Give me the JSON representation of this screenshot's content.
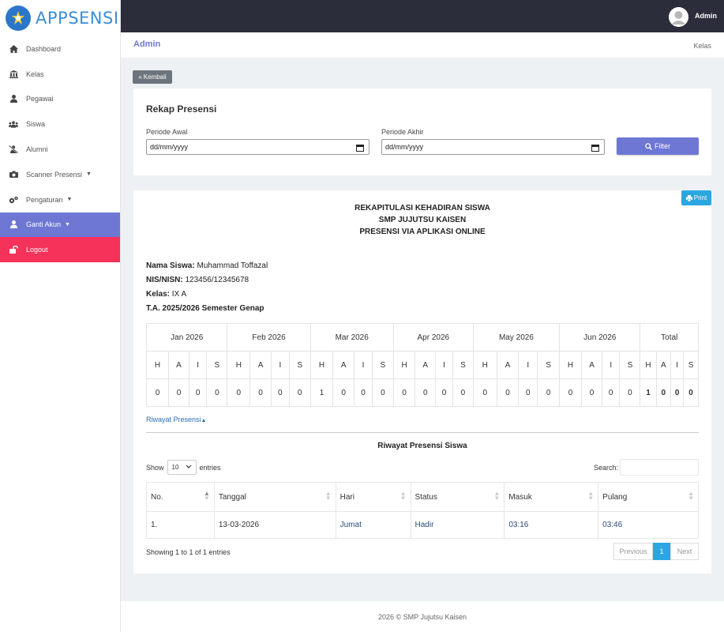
{
  "brand": {
    "name": "APPSENSI"
  },
  "sidebar": {
    "items": [
      {
        "label": "Dashboard",
        "icon": "home-icon"
      },
      {
        "label": "Kelas",
        "icon": "institution-icon"
      },
      {
        "label": "Pegawai",
        "icon": "user-tie-icon"
      },
      {
        "label": "Siswa",
        "icon": "users-icon"
      },
      {
        "label": "Alumni",
        "icon": "user-slash-icon"
      },
      {
        "label": "Scanner Presensi",
        "icon": "camera-icon"
      },
      {
        "label": "Pengaturan",
        "icon": "cogs-icon"
      },
      {
        "label": "Ganti Akun",
        "icon": "user-icon"
      },
      {
        "label": "Logout",
        "icon": "unlock-icon"
      }
    ]
  },
  "topbar": {
    "user": "Admin"
  },
  "breadcrumb": {
    "title": "Admin",
    "right": "Kelas"
  },
  "back_button": {
    "label": "Kembali"
  },
  "filter_card": {
    "title": "Rekap Presensi",
    "start_label": "Periode Awal",
    "start_value": "dd/mm/yyyy",
    "end_label": "Periode Akhir",
    "end_value": "dd/mm/yyyy",
    "filter_label": "Filter"
  },
  "report": {
    "print_label": "Print",
    "heading1": "REKAPITULASI KEHADIRAN SISWA",
    "heading2": "SMP JUJUTSU KAISEN",
    "heading3": "PRESENSI VIA APLIKASI ONLINE",
    "name_label": "Nama Siswa:",
    "name_value": "Muhammad Toffazal",
    "nis_label": "NIS/NISN:",
    "nis_value": "123456/12345678",
    "kelas_label": "Kelas:",
    "kelas_value": "IX A",
    "ta": "T.A. 2025/2026 Semester Genap",
    "months": [
      "Jan 2026",
      "Feb 2026",
      "Mar 2026",
      "Apr 2026",
      "May 2026",
      "Jun 2026",
      "Total"
    ],
    "status_codes": [
      "H",
      "A",
      "I",
      "S"
    ],
    "values": [
      [
        0,
        0,
        0,
        0
      ],
      [
        0,
        0,
        0,
        0
      ],
      [
        1,
        0,
        0,
        0
      ],
      [
        0,
        0,
        0,
        0
      ],
      [
        0,
        0,
        0,
        0
      ],
      [
        0,
        0,
        0,
        0
      ],
      [
        1,
        0,
        0,
        0
      ]
    ]
  },
  "riwayat": {
    "toggle_label": "Riwayat Presensi",
    "title": "Riwayat Presensi Siswa",
    "show_label": "Show",
    "show_value": "10",
    "entries_label": "entries",
    "search_label": "Search:",
    "columns": [
      "No.",
      "Tanggal",
      "Hari",
      "Status",
      "Masuk",
      "Pulang"
    ],
    "rows": [
      [
        "1.",
        "13-03-2026",
        "Jumat",
        "Hadir",
        "03:16",
        "03:46"
      ]
    ],
    "showing": "Showing 1 to 1 of 1 entries",
    "prev": "Previous",
    "page": "1",
    "next": "Next"
  },
  "footer": {
    "text": "2026 © SMP Jujutsu Kaisen"
  }
}
